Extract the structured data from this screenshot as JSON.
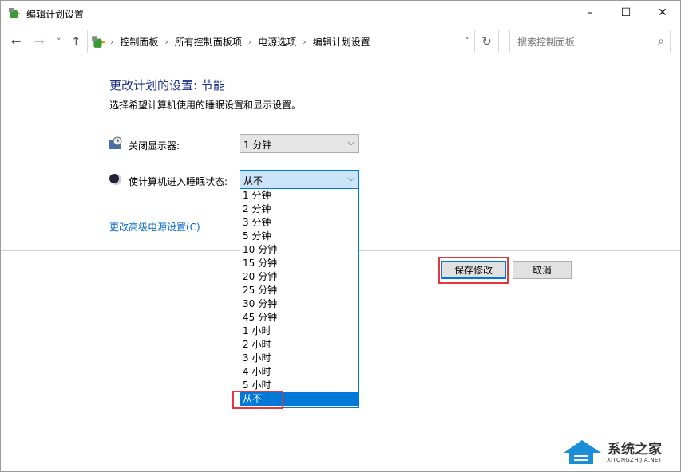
{
  "window": {
    "title": "编辑计划设置",
    "minimize": "–",
    "maximize": "☐",
    "close": "✕"
  },
  "nav": {
    "back": "←",
    "forward": "→",
    "recent": "˅",
    "up": "↑",
    "breadcrumb": [
      "控制面板",
      "所有控制面板项",
      "电源选项",
      "编辑计划设置"
    ],
    "separator": "›",
    "dropdown": "˅",
    "refresh": "↻",
    "search_placeholder": "搜索控制面板",
    "search_icon": "⌕"
  },
  "main": {
    "heading": "更改计划的设置: 节能",
    "description": "选择希望计算机使用的睡眠设置和显示设置。",
    "display_off": {
      "label": "关闭显示器:",
      "value": "1 分钟"
    },
    "sleep": {
      "label": "使计算机进入睡眠状态:",
      "value": "从不",
      "options": [
        "1 分钟",
        "2 分钟",
        "3 分钟",
        "5 分钟",
        "10 分钟",
        "15 分钟",
        "20 分钟",
        "25 分钟",
        "30 分钟",
        "45 分钟",
        "1 小时",
        "2 小时",
        "3 小时",
        "4 小时",
        "5 小时",
        "从不"
      ],
      "selected_index": 15
    },
    "advanced_link": "更改高级电源设置(C)",
    "save": "保存修改",
    "cancel": "取消",
    "chevron": "⌵"
  },
  "watermark": {
    "name": "系统之家",
    "url": "XITONGZHIJIA.NET"
  },
  "colors": {
    "accent": "#0078d7",
    "heading": "#1e3287",
    "highlight": "#e8353b"
  }
}
